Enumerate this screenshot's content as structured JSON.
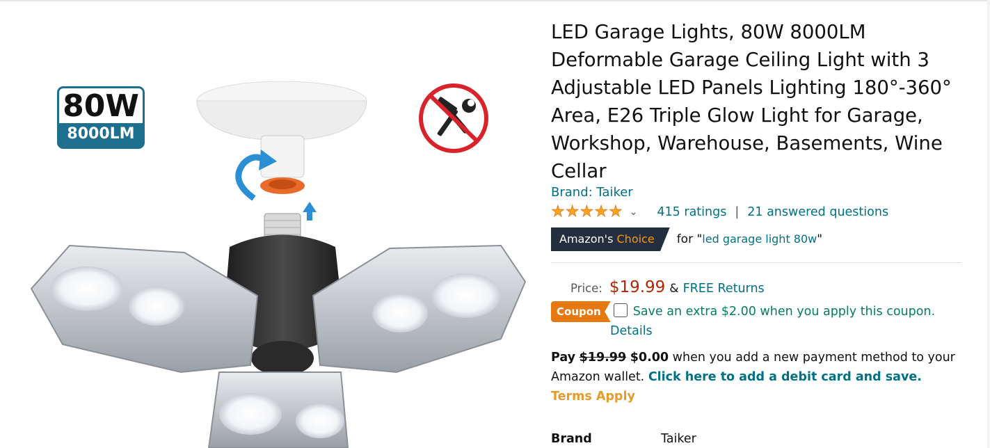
{
  "product": {
    "title": "LED Garage Lights, 80W 8000LM Deformable Garage Ceiling Light with 3 Adjustable LED Panels Lighting 180°-360° Area, E26 Triple Glow Light for Garage, Workshop, Warehouse, Basements, Wine Cellar",
    "brand_link": "Brand: Taiker",
    "image_badge": {
      "watts": "80W",
      "lumens": "8000LM"
    },
    "no_tools_icon": "no-tools-needed-icon"
  },
  "ratings": {
    "stars": 5,
    "ratings_count": "415 ratings",
    "separator": "|",
    "answered_questions": "21 answered questions"
  },
  "choice": {
    "label_prefix": "Amazon's",
    "label_highlight": "Choice",
    "for_text": "for \"",
    "keyword": "led garage light 80w",
    "for_suffix": "\""
  },
  "price": {
    "label": "Price:",
    "value": "$19.99",
    "amp": "&",
    "free_returns": "FREE Returns"
  },
  "coupon": {
    "tag": "Coupon",
    "text": "Save an extra $2.00 when you apply this coupon.",
    "details": "Details"
  },
  "pay": {
    "prefix": "Pay",
    "old_price": "$19.99",
    "new_price": "$0.00",
    "mid_text": "when you add a new payment method to your Amazon wallet.",
    "link_text": "Click here to add a debit card and save.",
    "terms": "Terms Apply"
  },
  "details_table": {
    "brand_key": "Brand",
    "brand_value": "Taiker"
  },
  "colors": {
    "link": "#007185",
    "price": "#B12704",
    "coupon_bg": "#E47911",
    "choice_bg": "#232F3E",
    "choice_accent": "#FF9900",
    "star": "#FFA41C",
    "coupon_text": "#067D62"
  }
}
